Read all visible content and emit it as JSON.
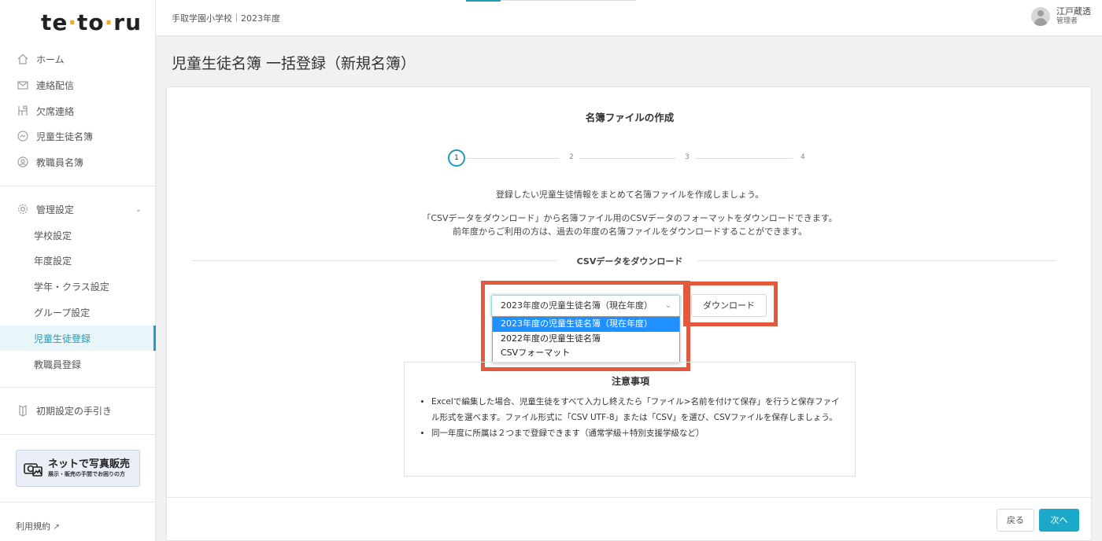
{
  "app": {
    "logo": "tetoru",
    "school": "手取学園小学校｜2023年度",
    "user_name": "江戸蔵透",
    "user_role": "管理者"
  },
  "sidebar": {
    "items": [
      {
        "label": "ホーム",
        "icon": "home-icon"
      },
      {
        "label": "連絡配信",
        "icon": "mail-icon"
      },
      {
        "label": "欠席連絡",
        "icon": "desk-icon"
      },
      {
        "label": "児童生徒名簿",
        "icon": "student-icon"
      },
      {
        "label": "教職員名簿",
        "icon": "teacher-icon"
      }
    ],
    "settings": {
      "label": "管理設定",
      "icon": "gear-icon"
    },
    "sub_items": [
      "学校設定",
      "年度設定",
      "学年・クラス設定",
      "グループ設定",
      "児童生徒登録",
      "教職員登録"
    ],
    "active_sub": "児童生徒登録",
    "guide": "初期設定の手引き",
    "banner_title": "ネットで写真販売",
    "banner_sub": "展示・販売の手間でお困りの方",
    "terms": "利用規約"
  },
  "page": {
    "title": "児童生徒名簿 一括登録（新規名簿）"
  },
  "card": {
    "title": "名簿ファイルの作成",
    "steps": [
      "1",
      "2",
      "3",
      "4"
    ],
    "current_step": 1,
    "lead": "登録したい児童生徒情報をまとめて名簿ファイルを作成しましょう。",
    "desc1": "「CSVデータをダウンロード」から名簿ファイル用のCSVデータのフォーマットをダウンロードできます。",
    "desc2": "前年度からご利用の方は、過去の年度の名簿ファイルをダウンロードすることができます。",
    "section_label": "CSVデータをダウンロード",
    "select_value": "2023年度の児童生徒名簿（現在年度）",
    "options": [
      "2023年度の児童生徒名簿（現在年度）",
      "2022年度の児童生徒名簿",
      "CSVフォーマット"
    ],
    "download_label": "ダウンロード",
    "notice_title": "注意事項",
    "notices": [
      "Excelで編集した場合、児童生徒をすべて入力し終えたら「ファイル>名前を付けて保存」を行うと保存ファイル形式を選べます。ファイル形式に「CSV UTF-8」または「CSV」を選び、CSVファイルを保存しましょう。",
      "同一年度に所属は２つまで登録できます（通常学級＋特別支援学級など）"
    ],
    "back_label": "戻る",
    "next_label": "次へ"
  },
  "colors": {
    "accent": "#1e9cb8",
    "highlight": "#e2593d",
    "selected_option": "#1e90ff",
    "next_button": "#1ba8c9"
  }
}
